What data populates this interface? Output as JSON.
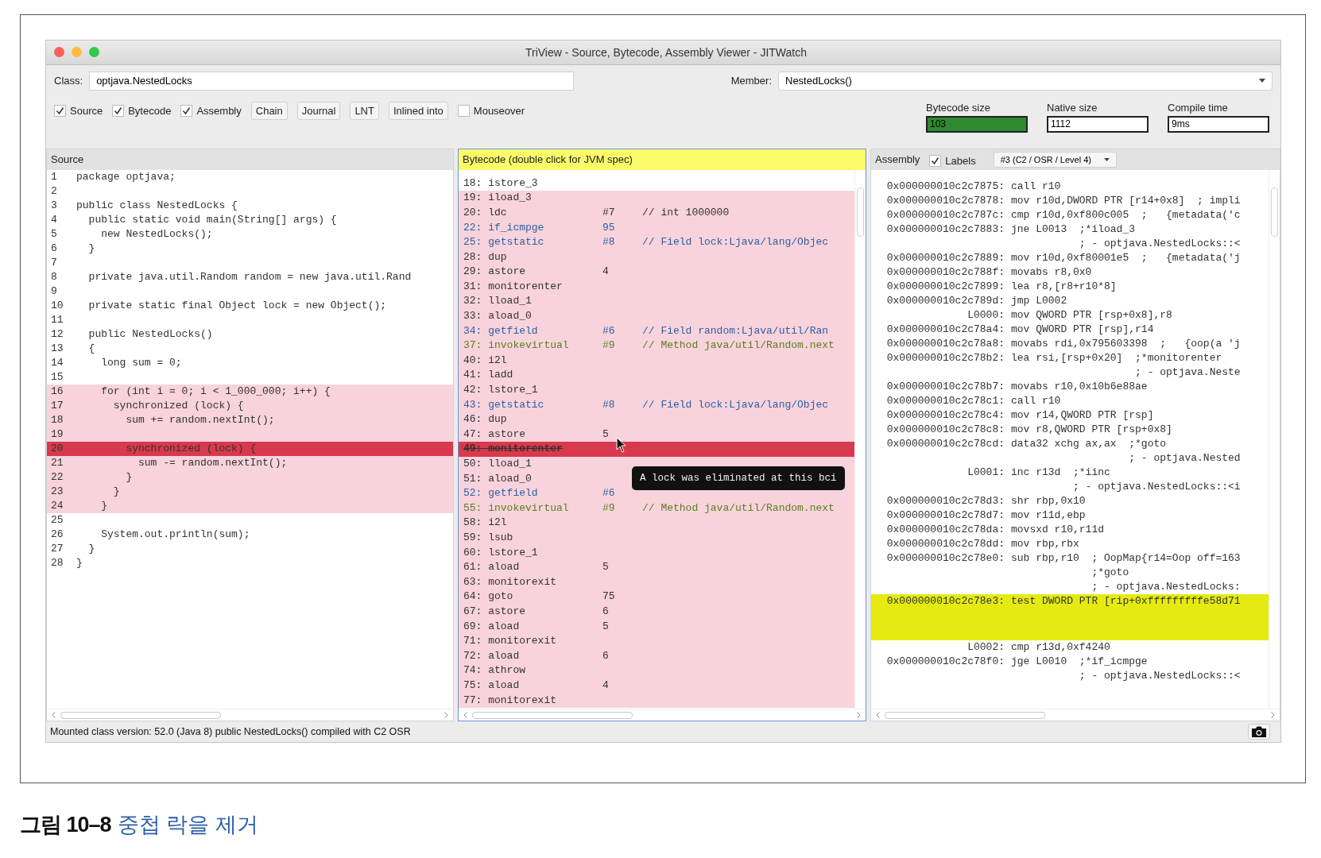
{
  "window": {
    "title": "TriView - Source, Bytecode, Assembly Viewer - JITWatch"
  },
  "class_field": {
    "label": "Class:",
    "value": "optjava.NestedLocks"
  },
  "member_field": {
    "label": "Member:",
    "value": "NestedLocks()"
  },
  "toolbar": [
    {
      "kind": "checkbox",
      "label": "Source",
      "checked": true
    },
    {
      "kind": "checkbox",
      "label": "Bytecode",
      "checked": true
    },
    {
      "kind": "checkbox",
      "label": "Assembly",
      "checked": true
    },
    {
      "kind": "button",
      "label": "Chain"
    },
    {
      "kind": "button",
      "label": "Journal"
    },
    {
      "kind": "button",
      "label": "LNT"
    },
    {
      "kind": "button",
      "label": "Inlined into"
    },
    {
      "kind": "checkbox",
      "label": "Mouseover",
      "checked": false
    }
  ],
  "metrics": [
    {
      "label": "Bytecode size",
      "value": "103",
      "color": "#2f8a2f"
    },
    {
      "label": "Native size",
      "value": "1112",
      "color": "#ffffff"
    },
    {
      "label": "Compile time",
      "value": "9ms",
      "color": "#ffffff"
    }
  ],
  "source": {
    "title": "Source",
    "highlighted": false,
    "lines": [
      {
        "num": "1",
        "code": "package optjava;",
        "highlighted": false,
        "current": false
      },
      {
        "num": "2",
        "highlighted": false,
        "current": false
      },
      {
        "num": "3",
        "code": "public class NestedLocks {",
        "highlighted": false,
        "current": false
      },
      {
        "num": "4",
        "code": "  public static void main(String[] args) {",
        "highlighted": false,
        "current": false
      },
      {
        "num": "5",
        "code": "    new NestedLocks();",
        "highlighted": false,
        "current": false
      },
      {
        "num": "6",
        "code": "  }",
        "highlighted": false,
        "current": false
      },
      {
        "num": "7",
        "highlighted": false,
        "current": false
      },
      {
        "num": "8",
        "code": "  private java.util.Random random = new java.util.Rand",
        "highlighted": false,
        "current": false
      },
      {
        "num": "9",
        "highlighted": false,
        "current": false
      },
      {
        "num": "10",
        "code": "  private static final Object lock = new Object();",
        "highlighted": false,
        "current": false
      },
      {
        "num": "11",
        "highlighted": false,
        "current": false
      },
      {
        "num": "12",
        "code": "  public NestedLocks()",
        "highlighted": false,
        "current": false
      },
      {
        "num": "13",
        "code": "  {",
        "highlighted": false,
        "current": false
      },
      {
        "num": "14",
        "code": "    long sum = 0;",
        "highlighted": false,
        "current": false
      },
      {
        "num": "15",
        "highlighted": false,
        "current": false
      },
      {
        "num": "16",
        "code": "    for (int i = 0; i < 1_000_000; i++) {",
        "highlighted": true,
        "current": false
      },
      {
        "num": "17",
        "code": "      synchronized (lock) {",
        "highlighted": true,
        "current": false
      },
      {
        "num": "18",
        "code": "        sum += random.nextInt();",
        "highlighted": true,
        "current": false
      },
      {
        "num": "19",
        "highlighted": true,
        "current": false
      },
      {
        "num": "20",
        "code": "        synchronized (lock) {",
        "highlighted": true,
        "current": true
      },
      {
        "num": "21",
        "code": "          sum -= random.nextInt();",
        "highlighted": true,
        "current": false
      },
      {
        "num": "22",
        "code": "        }",
        "highlighted": true,
        "current": false
      },
      {
        "num": "23",
        "code": "      }",
        "highlighted": true,
        "current": false
      },
      {
        "num": "24",
        "code": "    }",
        "highlighted": true,
        "current": false
      },
      {
        "num": "25",
        "highlighted": false,
        "current": false
      },
      {
        "num": "26",
        "code": "    System.out.println(sum);",
        "highlighted": false,
        "current": false
      },
      {
        "num": "27",
        "code": "  }",
        "highlighted": false,
        "current": false
      },
      {
        "num": "28",
        "code": "}",
        "highlighted": false,
        "current": false
      }
    ]
  },
  "bytecode": {
    "title": "Bytecode (double click for JVM spec)",
    "highlighted": true,
    "rows": [
      {
        "instruction": "18: istore_3",
        "highlighted": false,
        "current": false,
        "eliminated": false,
        "color": "#333333"
      },
      {
        "instruction": "19: iload_3",
        "highlighted": true,
        "current": false,
        "eliminated": false,
        "color": "#333333"
      },
      {
        "instruction": "20: ldc",
        "arg": "#7",
        "comment": "// int 1000000",
        "highlighted": true,
        "current": false,
        "eliminated": false,
        "color": "#333333"
      },
      {
        "instruction": "22: if_icmpge",
        "arg": "95",
        "highlighted": true,
        "current": false,
        "eliminated": false,
        "color": "#2f5fa0"
      },
      {
        "instruction": "25: getstatic",
        "arg": "#8",
        "comment": "// Field lock:Ljava/lang/Objec",
        "highlighted": true,
        "current": false,
        "eliminated": false,
        "color": "#2f5fa0"
      },
      {
        "instruction": "28: dup",
        "highlighted": true,
        "current": false,
        "eliminated": false,
        "color": "#333333"
      },
      {
        "instruction": "29: astore",
        "arg": "4",
        "highlighted": true,
        "current": false,
        "eliminated": false,
        "color": "#333333"
      },
      {
        "instruction": "31: monitorenter",
        "highlighted": true,
        "current": false,
        "eliminated": false,
        "color": "#333333"
      },
      {
        "instruction": "32: lload_1",
        "highlighted": true,
        "current": false,
        "eliminated": false,
        "color": "#333333"
      },
      {
        "instruction": "33: aload_0",
        "highlighted": true,
        "current": false,
        "eliminated": false,
        "color": "#333333"
      },
      {
        "instruction": "34: getfield",
        "arg": "#6",
        "comment": "// Field random:Ljava/util/Ran",
        "highlighted": true,
        "current": false,
        "eliminated": false,
        "color": "#2f5fa0"
      },
      {
        "instruction": "37: invokevirtual",
        "arg": "#9",
        "comment": "// Method java/util/Random.next",
        "highlighted": true,
        "current": false,
        "eliminated": false,
        "color": "#5a7f22"
      },
      {
        "instruction": "40: i2l",
        "highlighted": true,
        "current": false,
        "eliminated": false,
        "color": "#333333"
      },
      {
        "instruction": "41: ladd",
        "highlighted": true,
        "current": false,
        "eliminated": false,
        "color": "#333333"
      },
      {
        "instruction": "42: lstore_1",
        "highlighted": true,
        "current": false,
        "eliminated": false,
        "color": "#333333"
      },
      {
        "instruction": "43: getstatic",
        "arg": "#8",
        "comment": "// Field lock:Ljava/lang/Objec",
        "highlighted": true,
        "current": false,
        "eliminated": false,
        "color": "#2f5fa0"
      },
      {
        "instruction": "46: dup",
        "highlighted": true,
        "current": false,
        "eliminated": false,
        "color": "#333333"
      },
      {
        "instruction": "47: astore",
        "arg": "5",
        "highlighted": true,
        "current": false,
        "eliminated": false,
        "color": "#333333"
      },
      {
        "instruction": "49: monitorenter",
        "highlighted": true,
        "current": true,
        "eliminated": true
      },
      {
        "instruction": "50: lload_1",
        "highlighted": true,
        "current": false,
        "eliminated": false,
        "color": "#333333"
      },
      {
        "instruction": "51: aload_0",
        "highlighted": true,
        "current": false,
        "eliminated": false,
        "color": "#333333"
      },
      {
        "instruction": "52: getfield",
        "arg": "#6",
        "highlighted": true,
        "current": false,
        "eliminated": false,
        "color": "#2f5fa0"
      },
      {
        "instruction": "55: invokevirtual",
        "arg": "#9",
        "comment": "// Method java/util/Random.next",
        "highlighted": true,
        "current": false,
        "eliminated": false,
        "color": "#5a7f22"
      },
      {
        "instruction": "58: i2l",
        "highlighted": true,
        "current": false,
        "eliminated": false,
        "color": "#333333"
      },
      {
        "instruction": "59: lsub",
        "highlighted": true,
        "current": false,
        "eliminated": false,
        "color": "#333333"
      },
      {
        "instruction": "60: lstore_1",
        "highlighted": true,
        "current": false,
        "eliminated": false,
        "color": "#333333"
      },
      {
        "instruction": "61: aload",
        "arg": "5",
        "highlighted": true,
        "current": false,
        "eliminated": false,
        "color": "#333333"
      },
      {
        "instruction": "63: monitorexit",
        "highlighted": true,
        "current": false,
        "eliminated": false,
        "color": "#333333"
      },
      {
        "instruction": "64: goto",
        "arg": "75",
        "highlighted": true,
        "current": false,
        "eliminated": false,
        "color": "#333333"
      },
      {
        "instruction": "67: astore",
        "arg": "6",
        "highlighted": true,
        "current": false,
        "eliminated": false,
        "color": "#333333"
      },
      {
        "instruction": "69: aload",
        "arg": "5",
        "highlighted": true,
        "current": false,
        "eliminated": false,
        "color": "#333333"
      },
      {
        "instruction": "71: monitorexit",
        "highlighted": true,
        "current": false,
        "eliminated": false,
        "color": "#333333"
      },
      {
        "instruction": "72: aload",
        "arg": "6",
        "highlighted": true,
        "current": false,
        "eliminated": false,
        "color": "#333333"
      },
      {
        "instruction": "74: athrow",
        "highlighted": true,
        "current": false,
        "eliminated": false,
        "color": "#333333"
      },
      {
        "instruction": "75: aload",
        "arg": "4",
        "highlighted": true,
        "current": false,
        "eliminated": false,
        "color": "#333333"
      },
      {
        "instruction": "77: monitorexit",
        "highlighted": true,
        "current": false,
        "eliminated": false,
        "color": "#333333"
      }
    ],
    "tooltip": "A lock was eliminated at this bci"
  },
  "assembly": {
    "title": "Assembly",
    "highlighted": false,
    "labels_checkbox": {
      "label": "Labels",
      "checked": true
    },
    "compilation": "#3 (C2 / OSR / Level 4)",
    "lines": [
      {
        "addr": "0x000000010c2c7875:",
        "instr": "call r10",
        "highlighted": false
      },
      {
        "addr": "0x000000010c2c7878:",
        "instr": "mov r10d,DWORD PTR [r14+0x8]  ; impli",
        "highlighted": false
      },
      {
        "addr": "0x000000010c2c787c:",
        "instr": "cmp r10d,0xf800c005  ;   {metadata('c",
        "highlighted": false
      },
      {
        "addr": "0x000000010c2c7883:",
        "instr": "jne L0013  ;*iload_3",
        "highlighted": false
      },
      {
        "instr": "           ; - optjava.NestedLocks::<",
        "highlighted": false
      },
      {
        "addr": "0x000000010c2c7889:",
        "instr": "mov r10d,0xf80001e5  ;   {metadata('j",
        "highlighted": false
      },
      {
        "addr": "0x000000010c2c788f:",
        "instr": "movabs r8,0x0",
        "highlighted": false
      },
      {
        "addr": "0x000000010c2c7899:",
        "instr": "lea r8,[r8+r10*8]",
        "highlighted": false
      },
      {
        "addr": "0x000000010c2c789d:",
        "instr": "jmp L0002",
        "highlighted": false
      },
      {
        "addr": "L0000:",
        "instr": "mov QWORD PTR [rsp+0x8],r8",
        "highlighted": false
      },
      {
        "addr": "0x000000010c2c78a4:",
        "instr": "mov QWORD PTR [rsp],r14",
        "highlighted": false
      },
      {
        "addr": "0x000000010c2c78a8:",
        "instr": "movabs rdi,0x795603398  ;   {oop(a 'j",
        "highlighted": false
      },
      {
        "addr": "0x000000010c2c78b2:",
        "instr": "lea rsi,[rsp+0x20]  ;*monitorenter",
        "highlighted": false
      },
      {
        "instr": "                    ; - optjava.Neste",
        "highlighted": false
      },
      {
        "addr": "0x000000010c2c78b7:",
        "instr": "movabs r10,0x10b6e88ae",
        "highlighted": false
      },
      {
        "addr": "0x000000010c2c78c1:",
        "instr": "call r10",
        "highlighted": false
      },
      {
        "addr": "0x000000010c2c78c4:",
        "instr": "mov r14,QWORD PTR [rsp]",
        "highlighted": false
      },
      {
        "addr": "0x000000010c2c78c8:",
        "instr": "mov r8,QWORD PTR [rsp+0x8]",
        "highlighted": false
      },
      {
        "addr": "0x000000010c2c78cd:",
        "instr": "data32 xchg ax,ax  ;*goto",
        "highlighted": false
      },
      {
        "instr": "                   ; - optjava.Nested",
        "highlighted": false
      },
      {
        "addr": "L0001:",
        "instr": "inc r13d  ;*iinc",
        "highlighted": false
      },
      {
        "instr": "          ; - optjava.NestedLocks::<i",
        "highlighted": false
      },
      {
        "addr": "0x000000010c2c78d3:",
        "instr": "shr rbp,0x10",
        "highlighted": false
      },
      {
        "addr": "0x000000010c2c78d7:",
        "instr": "mov r11d,ebp",
        "highlighted": false
      },
      {
        "addr": "0x000000010c2c78da:",
        "instr": "movsxd r10,r11d",
        "highlighted": false
      },
      {
        "addr": "0x000000010c2c78dd:",
        "instr": "mov rbp,rbx",
        "highlighted": false
      },
      {
        "addr": "0x000000010c2c78e0:",
        "instr": "sub rbp,r10  ; OopMap{r14=Oop off=163",
        "highlighted": false
      },
      {
        "instr": "             ;*goto",
        "highlighted": false
      },
      {
        "instr": "             ; - optjava.NestedLocks:",
        "highlighted": false
      },
      {
        "addr": "0x000000010c2c78e3:",
        "instr": "test DWORD PTR [rip+0xfffffffffe58d71",
        "highlighted": true
      },
      {
        "addr": "L0002:",
        "instr": "cmp r13d,0xf4240",
        "highlighted": false
      },
      {
        "addr": "0x000000010c2c78f0:",
        "instr": "jge L0010  ;*if_icmpge",
        "highlighted": false
      },
      {
        "instr": "           ; - optjava.NestedLocks::<",
        "highlighted": false
      }
    ]
  },
  "status_bar": "Mounted class version: 52.0 (Java 8) public NestedLocks() compiled with C2 OSR",
  "caption": {
    "label": "그림 10–8",
    "text": "중첩 락을 제거"
  }
}
